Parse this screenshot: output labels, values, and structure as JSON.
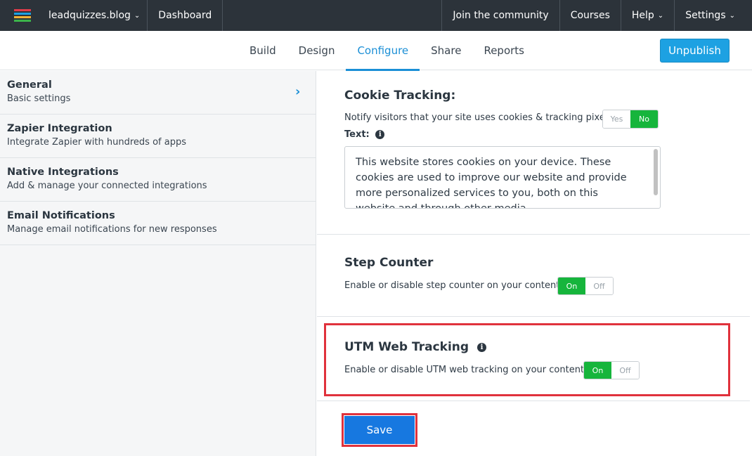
{
  "topnav": {
    "site_name": "leadquizzes.blog",
    "dashboard": "Dashboard",
    "community": "Join the community",
    "courses": "Courses",
    "help": "Help",
    "settings": "Settings",
    "logo_colors": [
      "#e23c4a",
      "#1da1e2",
      "#f2b233",
      "#3cb44b"
    ]
  },
  "subnav": {
    "tabs": [
      "Build",
      "Design",
      "Configure",
      "Share",
      "Reports"
    ],
    "active_tab": "Configure",
    "unpublish_label": "Unpublish"
  },
  "sidebar": {
    "items": [
      {
        "title": "General",
        "subtitle": "Basic settings"
      },
      {
        "title": "Zapier Integration",
        "subtitle": "Integrate Zapier with hundreds of apps"
      },
      {
        "title": "Native Integrations",
        "subtitle": "Add & manage your connected integrations"
      },
      {
        "title": "Email Notifications",
        "subtitle": "Manage email notifications for new responses"
      }
    ]
  },
  "cookie": {
    "title": "Cookie Tracking:",
    "desc": "Notify visitors that your site uses cookies & tracking pixel:",
    "yes": "Yes",
    "no": "No",
    "selected": "No",
    "text_label": "Text:",
    "text_value": "This website stores cookies on your device. These cookies are used to improve our website and provide more personalized services to you, both on this website and through other media."
  },
  "step_counter": {
    "title": "Step Counter",
    "desc": "Enable or disable step counter on your content:",
    "on": "On",
    "off": "Off",
    "selected": "On"
  },
  "utm": {
    "title": "UTM Web Tracking",
    "desc": "Enable or disable UTM web tracking on your content:",
    "on": "On",
    "off": "Off",
    "selected": "On"
  },
  "save_label": "Save",
  "colors": {
    "accent": "#1b8fd6",
    "toggle_on": "#16b53c",
    "highlight": "#e0323c",
    "save": "#1778e0"
  }
}
